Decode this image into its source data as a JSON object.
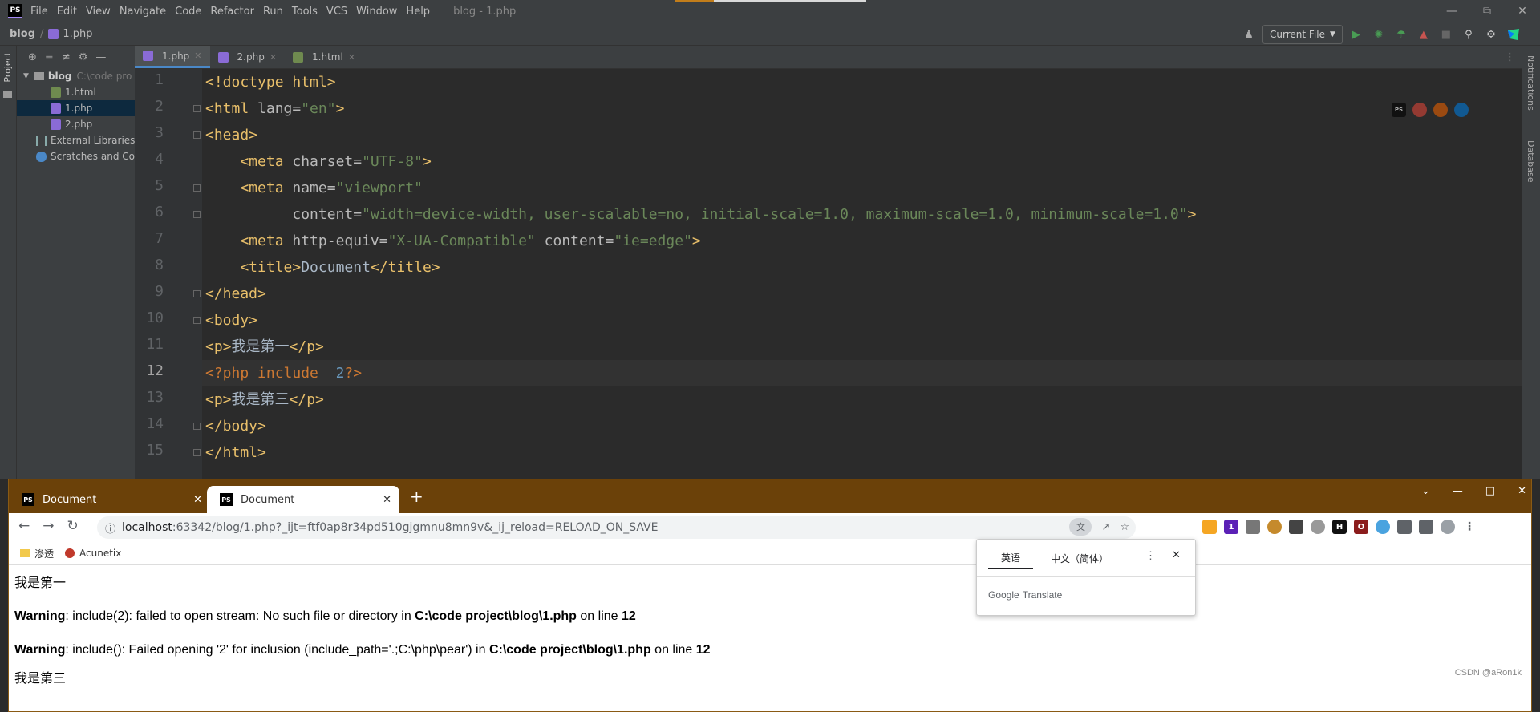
{
  "ide": {
    "logo": "PS",
    "menu": [
      "File",
      "Edit",
      "View",
      "Navigate",
      "Code",
      "Refactor",
      "Run",
      "Tools",
      "VCS",
      "Window",
      "Help"
    ],
    "window_title": "blog - 1.php",
    "breadcrumb": {
      "project": "blog",
      "file": "1.php"
    },
    "run_config": "Current File",
    "project_tab_label": "Project",
    "right_stripe": {
      "notifications": "Notifications",
      "database": "Database"
    },
    "tree": {
      "root": "blog",
      "root_path": "C:\\code pro",
      "files": [
        "1.html",
        "1.php",
        "2.php"
      ],
      "selected": "1.php",
      "external": "External Libraries",
      "scratches": "Scratches and Co"
    },
    "tabs": [
      {
        "label": "1.php",
        "active": true
      },
      {
        "label": "2.php",
        "active": false
      },
      {
        "label": "1.html",
        "active": false
      }
    ],
    "current_line": 12,
    "line_numbers": [
      "1",
      "2",
      "3",
      "4",
      "5",
      "6",
      "7",
      "8",
      "9",
      "10",
      "11",
      "12",
      "13",
      "14",
      "15"
    ]
  },
  "code": {
    "l1": {
      "a": "<!doctype html>"
    },
    "l2": {
      "a": "<html",
      "b": " lang=",
      "c": "\"en\"",
      "d": ">"
    },
    "l3": {
      "a": "<head>"
    },
    "l4": {
      "a": "    <meta",
      "b": " charset=",
      "c": "\"UTF-8\"",
      "d": ">"
    },
    "l5": {
      "a": "    <meta",
      "b": " name=",
      "c": "\"viewport\""
    },
    "l6": {
      "b": "          content=",
      "c": "\"width=device-width, user-scalable=no, initial-scale=1.0, maximum-scale=1.0, minimum-scale=1.0\"",
      "d": ">"
    },
    "l7": {
      "a": "    <meta",
      "b": " http-equiv=",
      "c": "\"X-UA-Compatible\"",
      "b2": " content=",
      "c2": "\"ie=edge\"",
      "d": ">"
    },
    "l8": {
      "a": "    <title>",
      "t": "Document",
      "d": "</title>"
    },
    "l9": {
      "a": "</head>"
    },
    "l10": {
      "a": "<body>"
    },
    "l11": {
      "a": "<p>",
      "t": "我是第一",
      "d": "</p>"
    },
    "l12": {
      "a": "<?php include  ",
      "n": "2",
      "d": "?>"
    },
    "l13": {
      "a": "<p>",
      "t": "我是第三",
      "d": "</p>"
    },
    "l14": {
      "a": "</body>"
    },
    "l15": {
      "a": "</html>"
    }
  },
  "browser": {
    "tabs": [
      {
        "label": "Document"
      },
      {
        "label": "Document"
      }
    ],
    "url_host": "localhost",
    "url_rest": ":63342/blog/1.php?_ijt=ftf0ap8r34pd510gjgmnu8mn9v&_ij_reload=RELOAD_ON_SAVE",
    "bookmarks": [
      {
        "label": "渗透"
      },
      {
        "label": "Acunetix"
      }
    ],
    "translate": {
      "tab_source": "英语",
      "tab_target": "中文（简体）",
      "brand_google": "Google",
      "brand_translate": "Translate"
    },
    "content": {
      "p1": "我是第一",
      "w1": {
        "bold1": "Warning",
        "text1": ": include(2): failed to open stream: No such file or directory in ",
        "bold2": "C:\\code project\\blog\\1.php",
        "text2": " on line ",
        "bold3": "12"
      },
      "w2": {
        "bold1": "Warning",
        "text1": ": include(): Failed opening '2' for inclusion (include_path='.;C:\\php\\pear') in ",
        "bold2": "C:\\code project\\blog\\1.php",
        "text2": " on line ",
        "bold3": "12"
      },
      "p3": "我是第三"
    },
    "watermark": "CSDN @aRon1k"
  },
  "colors": {
    "accent": "#4a88c7",
    "browser_frame": "#6b4109",
    "tag": "#e8bf6a",
    "string": "#6a8759",
    "keyword": "#cc7832"
  }
}
